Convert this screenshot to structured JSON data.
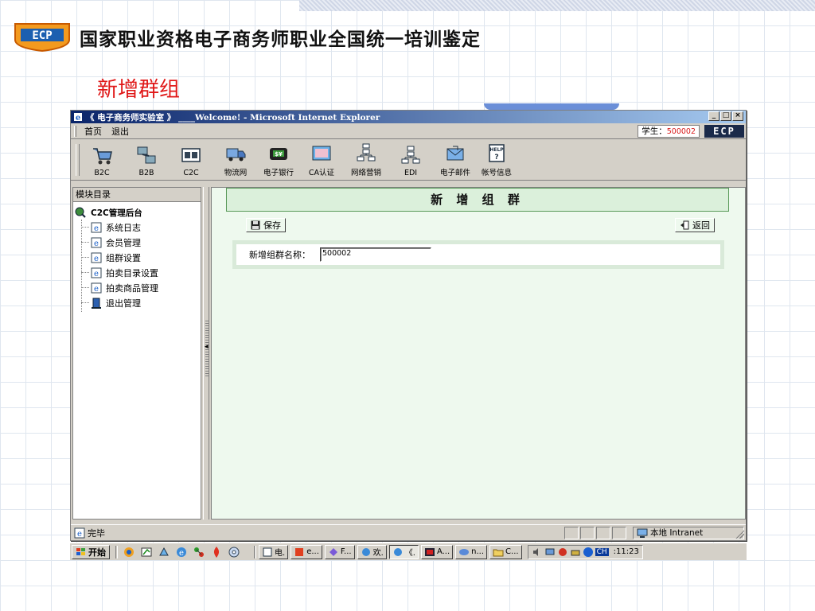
{
  "slide": {
    "title": "国家职业资格电子商务师职业全国统一培训鉴定",
    "subtitle": "新增群组"
  },
  "window": {
    "title": "《 电子商务师实验室 》 ____Welcome! - Microsoft Internet Explorer",
    "minimize": "_",
    "maximize": "□",
    "close": "×"
  },
  "menu": {
    "home": "首页",
    "logout": "退出",
    "student_label": "学生：",
    "student_id": "500002",
    "badge": "ECP"
  },
  "toolbar": {
    "items": [
      {
        "label": "B2C",
        "icon": "cart-icon"
      },
      {
        "label": "B2B",
        "icon": "b2b-network-icon"
      },
      {
        "label": "C2C",
        "icon": "c2c-icon"
      },
      {
        "label": "物流网",
        "icon": "truck-icon"
      },
      {
        "label": "电子银行",
        "icon": "bank-icon"
      },
      {
        "label": "CA认证",
        "icon": "certificate-icon"
      },
      {
        "label": "网络营销",
        "icon": "marketing-network-icon"
      },
      {
        "label": "EDI",
        "icon": "edi-network-icon"
      },
      {
        "label": "电子邮件",
        "icon": "email-icon"
      },
      {
        "label": "帐号信息",
        "icon": "help-account-icon"
      }
    ]
  },
  "sidebar": {
    "header": "模块目录",
    "root": "C2C管理后台",
    "items": [
      "系统日志",
      "会员管理",
      "组群设置",
      "拍卖目录设置",
      "拍卖商品管理",
      "退出管理"
    ]
  },
  "content": {
    "title": "新 增 组 群",
    "save_label": "保存",
    "back_label": "返回",
    "field_label": "新增组群名称：",
    "field_value": "500002"
  },
  "status": {
    "text": "完毕",
    "zone": "本地 Intranet"
  },
  "taskbar": {
    "start": "开始",
    "tasks": [
      "电.",
      "e...",
      "F...",
      "欢.",
      "《.",
      "A...",
      "n...",
      "C..."
    ],
    "lang": "CH",
    "clock": ":11:23"
  }
}
